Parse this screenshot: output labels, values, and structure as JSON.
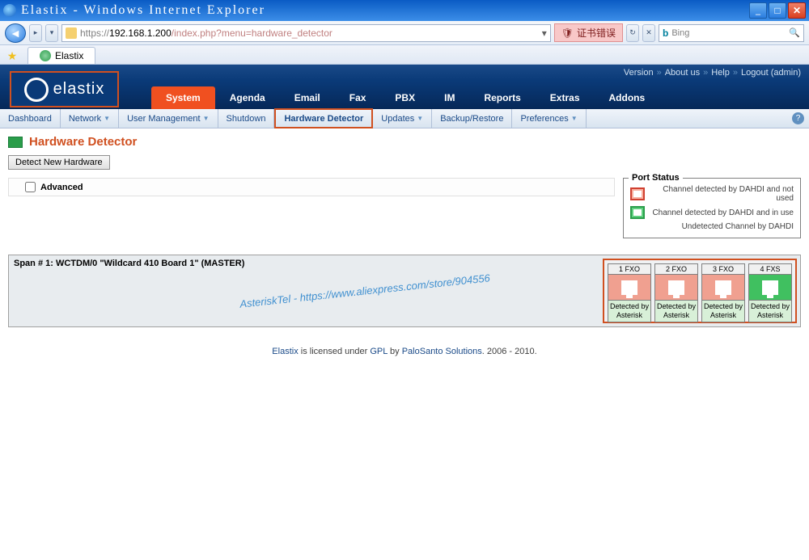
{
  "window": {
    "title": "Elastix - Windows Internet Explorer",
    "min": "_",
    "max": "□",
    "close": "✕"
  },
  "url": {
    "protocol": "https://",
    "host": "192.168.1.200",
    "path": "/index.php?menu=hardware_detector",
    "cert_error": "证书错误",
    "search_provider": "Bing"
  },
  "browser_tab": {
    "label": "Elastix"
  },
  "top_links": {
    "version": "Version",
    "about": "About us",
    "help": "Help",
    "logout": "Logout (admin)"
  },
  "logo_text": "elastix",
  "main_menu": [
    "System",
    "Agenda",
    "Email",
    "Fax",
    "PBX",
    "IM",
    "Reports",
    "Extras",
    "Addons"
  ],
  "main_menu_active": 0,
  "sub_menu": [
    {
      "label": "Dashboard",
      "dd": false
    },
    {
      "label": "Network",
      "dd": true
    },
    {
      "label": "User Management",
      "dd": true
    },
    {
      "label": "Shutdown",
      "dd": false
    },
    {
      "label": "Hardware Detector",
      "dd": false,
      "active": true
    },
    {
      "label": "Updates",
      "dd": true
    },
    {
      "label": "Backup/Restore",
      "dd": false
    },
    {
      "label": "Preferences",
      "dd": true
    }
  ],
  "page": {
    "title": "Hardware Detector",
    "detect_btn": "Detect New Hardware",
    "advanced": "Advanced"
  },
  "port_status": {
    "title": "Port Status",
    "rows": [
      {
        "color": "red",
        "text": "Channel detected by DAHDI and not used"
      },
      {
        "color": "green",
        "text": "Channel detected by DAHDI and in use"
      },
      {
        "color": "none",
        "text": "Undetected Channel by DAHDI"
      }
    ]
  },
  "span": {
    "title": "Span # 1: WCTDM/0 \"Wildcard 410 Board 1\" (MASTER)",
    "watermark": "AsteriskTel - https://www.aliexpress.com/store/904556",
    "ports": [
      {
        "label": "1 FXO",
        "type": "fxo",
        "status": "Detected by Asterisk"
      },
      {
        "label": "2 FXO",
        "type": "fxo",
        "status": "Detected by Asterisk"
      },
      {
        "label": "3 FXO",
        "type": "fxo",
        "status": "Detected by Asterisk"
      },
      {
        "label": "4 FXS",
        "type": "fxs",
        "status": "Detected by Asterisk"
      }
    ]
  },
  "footer": {
    "p1": "Elastix",
    "p2": " is licensed under ",
    "p3": "GPL",
    "p4": " by ",
    "p5": "PaloSanto Solutions",
    "p6": ". 2006 - 2010."
  }
}
